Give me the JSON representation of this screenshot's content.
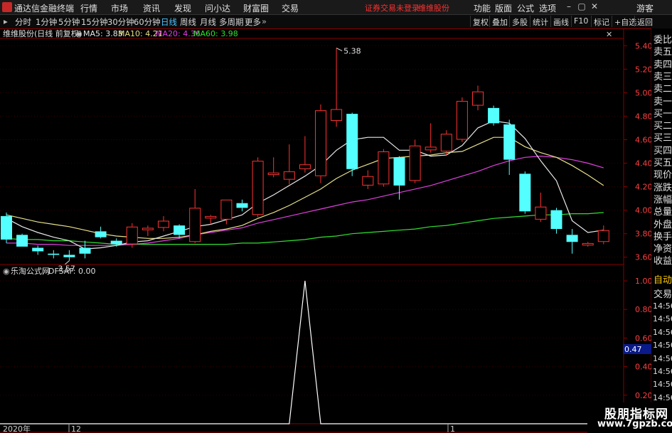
{
  "titlebar": {
    "app_title": "通达信金融终端",
    "menus": [
      "行情",
      "市场",
      "资讯",
      "发现",
      "问小达",
      "财富圈",
      "交易"
    ],
    "warning": "证券交易未登录",
    "stock_name": "维维股份",
    "right_menus": [
      "功能",
      "版面",
      "公式",
      "选项"
    ],
    "guest": "游客"
  },
  "toolbar": {
    "periods": [
      "分时",
      "1分钟",
      "5分钟",
      "15分钟",
      "30分钟",
      "60分钟",
      "日线",
      "周线",
      "月线",
      "多周期",
      "更多"
    ],
    "active_period": "日线",
    "tools": [
      "复权",
      "叠加",
      "多股",
      "统计",
      "画线",
      "F10",
      "标记",
      "+自选",
      "返回"
    ]
  },
  "main_legend": {
    "title": "维维股份(日线 前复权)",
    "ma5": "MA5: 3.83",
    "ma10": "MA10: 4.21",
    "ma20": "MA20: 4.36",
    "ma60": "MA60: 3.98"
  },
  "sub_legend": {
    "title": "乐淘公式网",
    "value": "DFSAF: 0.00"
  },
  "annotations": {
    "high": "5.38",
    "low": "3.57"
  },
  "price_axis": [
    "5.40",
    "5.20",
    "5.00",
    "4.80",
    "4.60",
    "4.40",
    "4.20",
    "4.00",
    "3.80",
    "3.60"
  ],
  "sub_axis": [
    "1.00",
    "0.80",
    "0.60",
    "0.40",
    "0.20"
  ],
  "sub_current": "0.47",
  "time_axis": [
    "2020年",
    "12",
    "1"
  ],
  "side_panel": [
    "委比",
    "卖五",
    "卖四",
    "卖三",
    "卖二",
    "卖一",
    "买一",
    "买二",
    "买三",
    "买四",
    "买五",
    "现价",
    "涨跌",
    "涨幅",
    "总量",
    "外盘",
    "换手",
    "净资",
    "收益"
  ],
  "side_tabs": [
    "自动",
    "交易"
  ],
  "side_times": [
    "14:56",
    "14:56",
    "14:56",
    "14:56",
    "14:56",
    "14:56",
    "14:56",
    "14:56",
    "14:56",
    "14:56"
  ],
  "watermark": {
    "line1": "股朋指标网",
    "line2": "www.7gpzb.com"
  },
  "colors": {
    "up": "#ff3232",
    "down": "#54ffff",
    "ma5": "#e8e8e8",
    "ma10": "#e8e08a",
    "ma20": "#e040e0",
    "ma60": "#30e030",
    "grid": "#8b0000"
  },
  "chart_data": {
    "type": "candlestick",
    "price_range": [
      3.55,
      5.45
    ],
    "candles": [
      {
        "o": 3.95,
        "h": 3.98,
        "l": 3.72,
        "c": 3.75
      },
      {
        "o": 3.79,
        "h": 3.8,
        "l": 3.69,
        "c": 3.69
      },
      {
        "o": 3.68,
        "h": 3.7,
        "l": 3.62,
        "c": 3.65
      },
      {
        "o": 3.63,
        "h": 3.66,
        "l": 3.59,
        "c": 3.62
      },
      {
        "o": 3.62,
        "h": 3.66,
        "l": 3.57,
        "c": 3.6
      },
      {
        "o": 3.68,
        "h": 3.74,
        "l": 3.59,
        "c": 3.63
      },
      {
        "o": 3.82,
        "h": 3.86,
        "l": 3.76,
        "c": 3.77
      },
      {
        "o": 3.74,
        "h": 3.76,
        "l": 3.69,
        "c": 3.71
      },
      {
        "o": 3.71,
        "h": 3.89,
        "l": 3.68,
        "c": 3.86
      },
      {
        "o": 3.83,
        "h": 3.87,
        "l": 3.78,
        "c": 3.85
      },
      {
        "o": 3.85,
        "h": 3.95,
        "l": 3.82,
        "c": 3.91
      },
      {
        "o": 3.87,
        "h": 3.88,
        "l": 3.76,
        "c": 3.79
      },
      {
        "o": 3.73,
        "h": 4.18,
        "l": 3.72,
        "c": 4.02
      },
      {
        "o": 3.93,
        "h": 3.96,
        "l": 3.88,
        "c": 3.95
      },
      {
        "o": 3.92,
        "h": 4.09,
        "l": 3.88,
        "c": 4.09
      },
      {
        "o": 4.06,
        "h": 4.09,
        "l": 3.99,
        "c": 4.02
      },
      {
        "o": 3.96,
        "h": 4.45,
        "l": 3.94,
        "c": 4.42
      },
      {
        "o": 4.3,
        "h": 4.45,
        "l": 4.28,
        "c": 4.32
      },
      {
        "o": 4.26,
        "h": 4.56,
        "l": 4.22,
        "c": 4.33
      },
      {
        "o": 4.35,
        "h": 4.63,
        "l": 4.32,
        "c": 4.39
      },
      {
        "o": 4.29,
        "h": 4.9,
        "l": 4.23,
        "c": 4.85
      },
      {
        "o": 4.76,
        "h": 5.38,
        "l": 4.71,
        "c": 4.86
      },
      {
        "o": 4.82,
        "h": 4.83,
        "l": 4.29,
        "c": 4.35
      },
      {
        "o": 4.21,
        "h": 4.34,
        "l": 4.18,
        "c": 4.29
      },
      {
        "o": 4.22,
        "h": 4.52,
        "l": 4.2,
        "c": 4.5
      },
      {
        "o": 4.45,
        "h": 4.46,
        "l": 4.09,
        "c": 4.21
      },
      {
        "o": 4.25,
        "h": 4.6,
        "l": 4.23,
        "c": 4.55
      },
      {
        "o": 4.51,
        "h": 4.74,
        "l": 4.49,
        "c": 4.54
      },
      {
        "o": 4.5,
        "h": 4.68,
        "l": 4.47,
        "c": 4.65
      },
      {
        "o": 4.6,
        "h": 4.96,
        "l": 4.58,
        "c": 4.93
      },
      {
        "o": 4.89,
        "h": 5.06,
        "l": 4.85,
        "c": 5.01
      },
      {
        "o": 4.87,
        "h": 4.89,
        "l": 4.72,
        "c": 4.74
      },
      {
        "o": 4.73,
        "h": 4.77,
        "l": 4.3,
        "c": 4.43
      },
      {
        "o": 4.31,
        "h": 4.33,
        "l": 3.97,
        "c": 3.99
      },
      {
        "o": 3.92,
        "h": 4.15,
        "l": 3.9,
        "c": 4.03
      },
      {
        "o": 4.0,
        "h": 4.02,
        "l": 3.8,
        "c": 3.84
      },
      {
        "o": 3.79,
        "h": 3.84,
        "l": 3.63,
        "c": 3.73
      },
      {
        "o": 3.7,
        "h": 3.73,
        "l": 3.69,
        "c": 3.72
      },
      {
        "o": 3.73,
        "h": 3.87,
        "l": 3.71,
        "c": 3.83
      }
    ],
    "ma5": [
      3.93,
      3.86,
      3.81,
      3.77,
      3.74,
      3.67,
      3.68,
      3.7,
      3.73,
      3.74,
      3.78,
      3.82,
      3.86,
      3.88,
      3.92,
      3.96,
      4.06,
      4.13,
      4.21,
      4.29,
      4.38,
      4.51,
      4.6,
      4.62,
      4.62,
      4.51,
      4.51,
      4.46,
      4.47,
      4.55,
      4.7,
      4.76,
      4.74,
      4.61,
      4.42,
      4.25,
      3.91,
      3.81,
      3.83
    ],
    "ma10": [
      3.96,
      3.93,
      3.9,
      3.88,
      3.86,
      3.83,
      3.8,
      3.78,
      3.77,
      3.76,
      3.76,
      3.77,
      3.79,
      3.82,
      3.84,
      3.87,
      3.93,
      3.98,
      4.04,
      4.11,
      4.18,
      4.27,
      4.34,
      4.39,
      4.44,
      4.45,
      4.46,
      4.47,
      4.49,
      4.5,
      4.56,
      4.62,
      4.62,
      4.54,
      4.49,
      4.45,
      4.38,
      4.3,
      4.21
    ],
    "ma20": [
      3.72,
      3.72,
      3.71,
      3.71,
      3.7,
      3.7,
      3.7,
      3.7,
      3.71,
      3.72,
      3.74,
      3.76,
      3.79,
      3.81,
      3.83,
      3.85,
      3.89,
      3.92,
      3.95,
      3.98,
      4.01,
      4.04,
      4.07,
      4.09,
      4.12,
      4.15,
      4.18,
      4.21,
      4.25,
      4.29,
      4.33,
      4.38,
      4.42,
      4.45,
      4.46,
      4.45,
      4.43,
      4.4,
      4.36
    ],
    "ma60": [
      3.76,
      3.75,
      3.75,
      3.74,
      3.74,
      3.73,
      3.72,
      3.71,
      3.71,
      3.71,
      3.71,
      3.71,
      3.71,
      3.71,
      3.71,
      3.72,
      3.72,
      3.73,
      3.74,
      3.75,
      3.77,
      3.78,
      3.8,
      3.81,
      3.82,
      3.83,
      3.84,
      3.86,
      3.87,
      3.89,
      3.91,
      3.93,
      3.94,
      3.95,
      3.96,
      3.96,
      3.97,
      3.97,
      3.98
    ],
    "indicator": {
      "name": "DFSAF",
      "range": [
        0,
        1.05
      ],
      "values": [
        0,
        0,
        0,
        0,
        0,
        0,
        0,
        0,
        0,
        0,
        0,
        0,
        0,
        0,
        0,
        0,
        0,
        0,
        0,
        1,
        0,
        0,
        0,
        0,
        0,
        0,
        0,
        0,
        0,
        0,
        0,
        0,
        0,
        0,
        0,
        0,
        0,
        0,
        0
      ]
    }
  }
}
